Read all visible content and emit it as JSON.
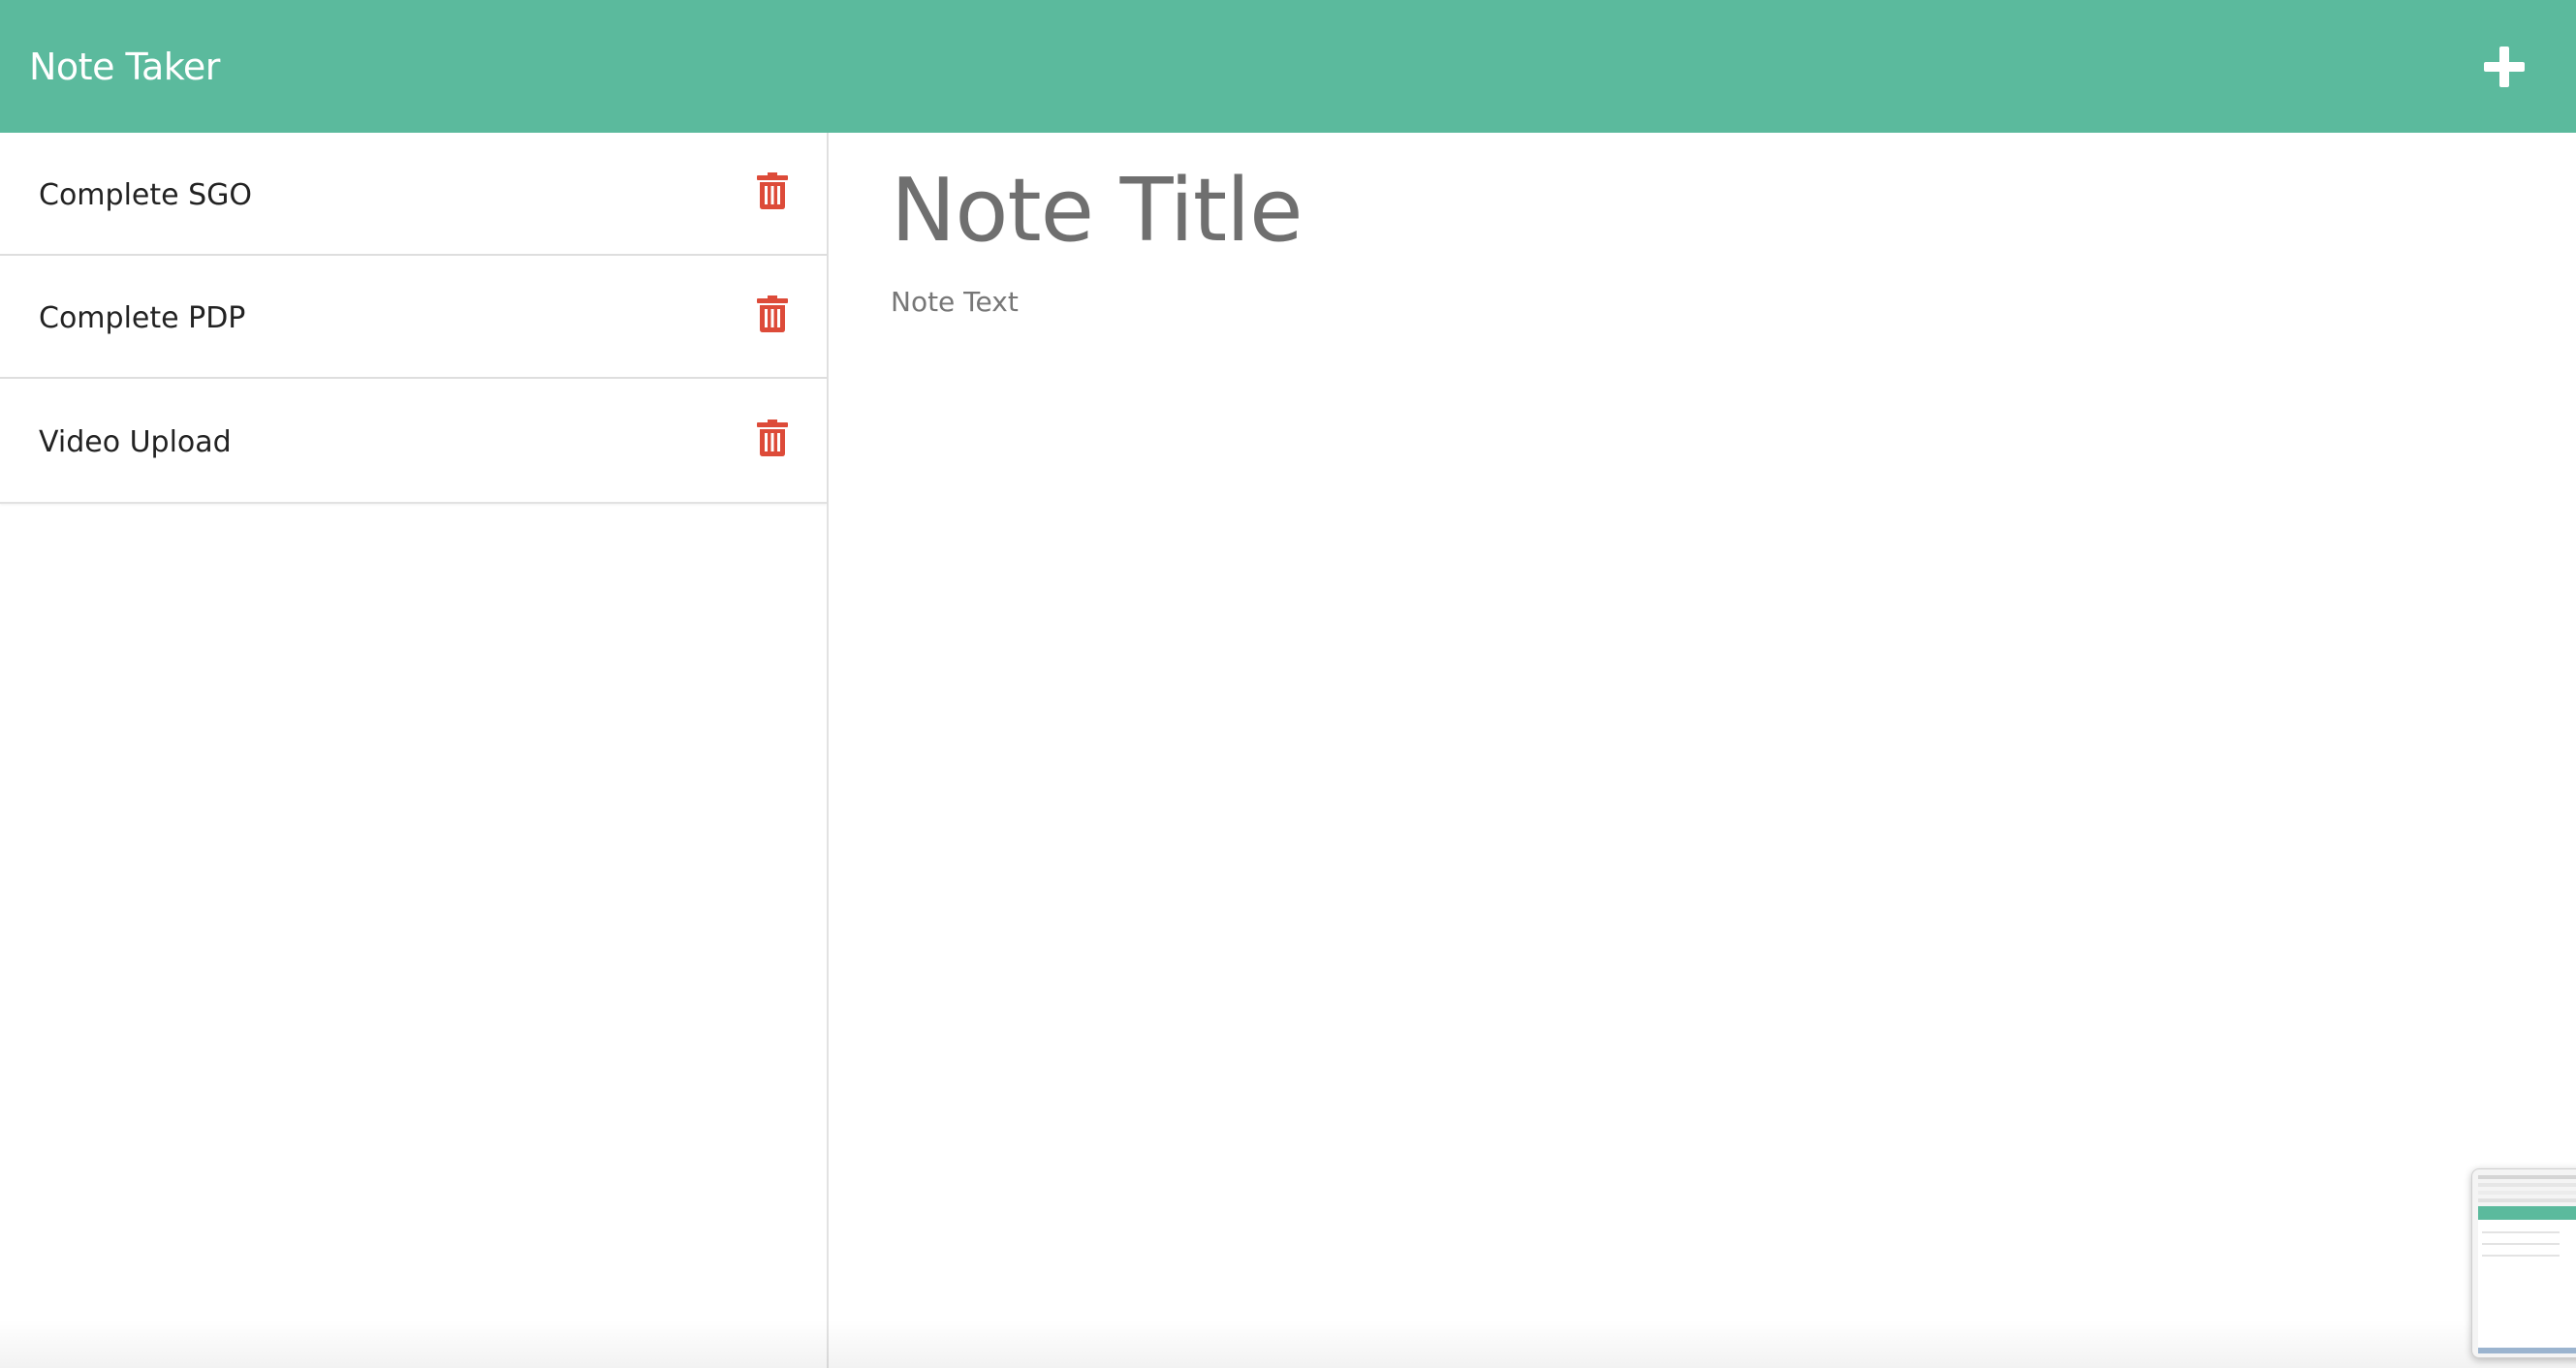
{
  "navbar": {
    "brand": "Note Taker",
    "new_note_icon": "plus-icon"
  },
  "sidebar": {
    "notes": [
      {
        "title": "Complete SGO",
        "delete_icon": "trash-icon"
      },
      {
        "title": "Complete PDP",
        "delete_icon": "trash-icon"
      },
      {
        "title": "Video Upload",
        "delete_icon": "trash-icon"
      }
    ]
  },
  "editor": {
    "title_placeholder": "Note Title",
    "text_placeholder": "Note Text"
  },
  "colors": {
    "navbar": "#5bba9d",
    "delete_icon": "#dd4b39",
    "text": "#222222",
    "placeholder": "#6f6f6f"
  }
}
